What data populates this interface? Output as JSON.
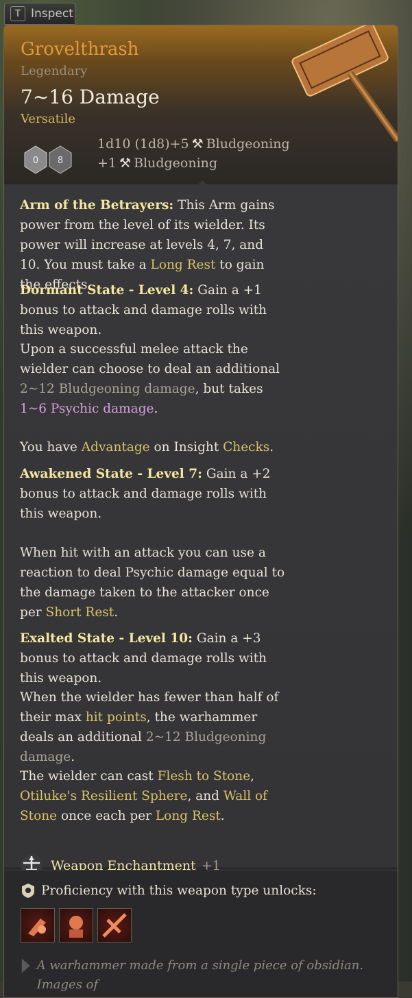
{
  "inspect_tab": {
    "key": "T",
    "label": "Inspect"
  },
  "item": {
    "name": "Grovelthrash",
    "rarity": "Legendary",
    "damage": "7~16 Damage",
    "property": "Versatile",
    "damage_lines": [
      {
        "dice": "1d10 (1d8)+5",
        "type": "Bludgeoning"
      },
      {
        "dice": "+1",
        "type": "Bludgeoning"
      }
    ],
    "dice_faces": [
      "0",
      "8"
    ]
  },
  "colors": {
    "name": "#e09a3a",
    "keyword": "#d8c16a",
    "psychic": "#d89ee0",
    "bold": "#f5e6a0"
  },
  "description": {
    "arm_title": "Arm of the Betrayers:",
    "arm_text1": " This Arm gains power from the level of its wielder. Its power will increase at levels 4, 7, and 10. You must take a ",
    "arm_link": "Long Rest",
    "arm_text2": " to gain the effects.",
    "dormant_title": "Dormant State - Level 4:",
    "dormant_text": " Gain a +1 bonus to attack and damage rolls with this weapon.",
    "melee_text1": "Upon a successful melee attack the wielder can choose to deal an additional ",
    "melee_dmg": "2~12 Bludgeoning damage",
    "melee_text2": ", but takes ",
    "melee_psychic": "1~6 Psychic damage",
    "melee_text3": ".",
    "adv_text1": "You have ",
    "adv_link": "Advantage",
    "adv_text2": " on Insight ",
    "adv_link2": "Checks",
    "adv_text3": ".",
    "awakened_title": "Awakened State - Level 7:",
    "awakened_text": " Gain a +2 bonus to attack and damage rolls with this weapon.",
    "hit_text1": "When hit with an attack you can use a reaction to deal Psychic damage equal to the damage taken to the attacker once per ",
    "hit_link": "Short Rest",
    "hit_text2": ".",
    "exalted_title": "Exalted State - Level 10:",
    "exalted_text": " Gain a +3 bonus to attack and damage rolls with this weapon.",
    "half_text1": "When the wielder has fewer than half of their max ",
    "half_link": "hit points",
    "half_text2": ", the warhammer deals an additional ",
    "half_dmg": "2~12 Bludgeoning damage",
    "half_text3": ".",
    "cast_text1": "The wielder can cast ",
    "cast_link1": "Flesh to Stone",
    "cast_text2": ", ",
    "cast_link2": "Otiluke's Resilient Sphere",
    "cast_text3": ", and ",
    "cast_link3": "Wall of Stone",
    "cast_text4": " once each per ",
    "cast_link4": "Long Rest",
    "cast_text5": "."
  },
  "enchantment": {
    "label": "Weapon Enchantment",
    "value": "+1"
  },
  "proficiency": {
    "label": "Proficiency with this weapon type unlocks:",
    "icons": [
      "action-icon-1",
      "action-icon-2",
      "action-icon-3"
    ]
  },
  "flavor": "A warhammer made from a single piece of obsidian. Images of"
}
